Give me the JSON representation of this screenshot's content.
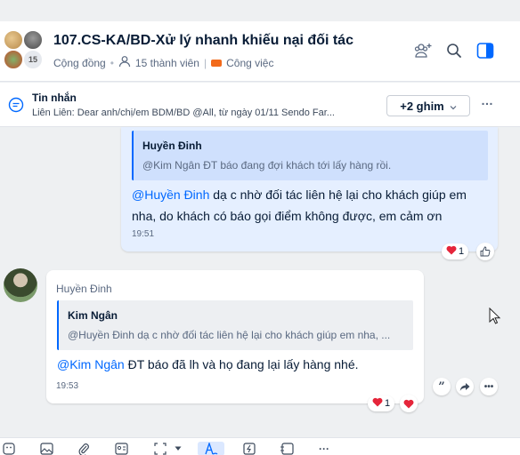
{
  "header": {
    "title": "107.CS-KA/BD-Xử lý nhanh khiếu nại đối tác",
    "avatar_count": "15",
    "type": "Cộng đồng",
    "members": "15 thành viên",
    "category": "Công việc",
    "icons": [
      "add-member-icon",
      "search-icon",
      "side-panel-icon"
    ]
  },
  "pinned": {
    "label": "Tin nhắn",
    "text": "Liên Liên: Dear anh/chị/em BDM/BD @All, từ ngày 01/11 Sendo Far...",
    "more_pins_label": "+2 ghim",
    "more_icon": "…"
  },
  "messages": [
    {
      "quote_name": "Huyền Đinh",
      "quote_text": "@Kim Ngân ĐT báo đang đợi khách tới lấy hàng rồi.",
      "mention": "@Huyền Đinh",
      "text_line1": " dạ c nhờ đối tác liên hệ lại cho khách giúp em",
      "text_line2": "nha, do khách có báo gọi điểm không được, em cảm ơn",
      "time": "19:51",
      "reaction_count": "1"
    },
    {
      "sender": "Huyền Đinh",
      "quote_name": "Kim Ngân",
      "quote_text": "@Huyền Đinh dạ c nhờ đối tác liên hệ lại cho khách giúp em nha, ...",
      "mention": "@Kim Ngân",
      "text": " ĐT báo đã lh và họ đang lại lấy hàng nhé.",
      "time": "19:53",
      "reaction_count": "1"
    }
  ],
  "colors": {
    "accent": "#0068ff",
    "own_bubble": "#e5efff",
    "heart": "#e5253a"
  }
}
